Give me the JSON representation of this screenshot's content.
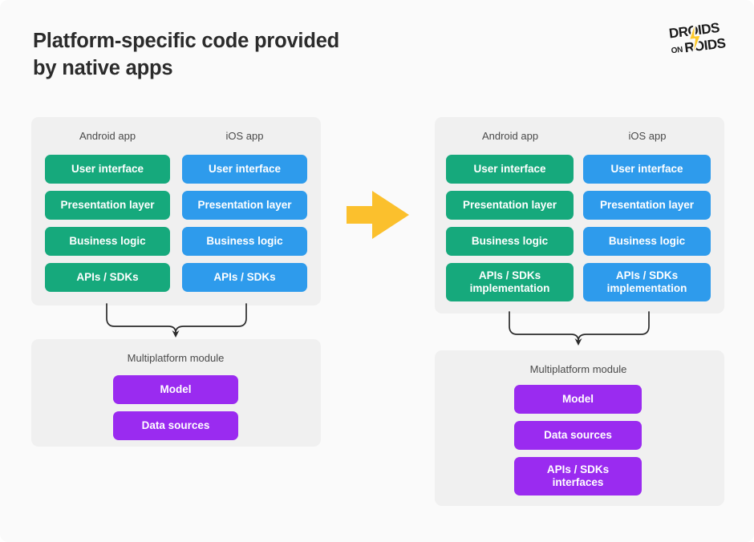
{
  "page": {
    "background_color": "#fafafa",
    "title": "Platform-specific code provided\nby native apps"
  },
  "logo": {
    "name": "droids-on-roids-logo",
    "line1": "DROIDS",
    "line2_prefix": "ON",
    "line2": "ROIDS",
    "bolt_color": "#ffc929",
    "text_color": "#1a1a1a"
  },
  "colors": {
    "android": "#16a97c",
    "ios": "#2e9bec",
    "multiplatform": "#9a2bf0",
    "arrow": "#fbc02d",
    "panel": "#f0f0f0",
    "connector": "#2b2b2b"
  },
  "center_arrow": {
    "name": "transition-arrow",
    "direction": "right",
    "color": "#fbc02d"
  },
  "before": {
    "apps_panel": {
      "columns": [
        {
          "label": "Android app",
          "color": "#16a97c",
          "boxes": [
            "User interface",
            "Presentation layer",
            "Business logic",
            "APIs / SDKs"
          ]
        },
        {
          "label": "iOS app",
          "color": "#2e9bec",
          "boxes": [
            "User interface",
            "Presentation layer",
            "Business logic",
            "APIs / SDKs"
          ]
        }
      ]
    },
    "module_panel": {
      "label": "Multiplatform module",
      "color": "#9a2bf0",
      "boxes": [
        "Model",
        "Data sources"
      ]
    }
  },
  "after": {
    "apps_panel": {
      "columns": [
        {
          "label": "Android app",
          "color": "#16a97c",
          "boxes": [
            "User interface",
            "Presentation layer",
            "Business logic",
            "APIs / SDKs\nimplementation"
          ]
        },
        {
          "label": "iOS app",
          "color": "#2e9bec",
          "boxes": [
            "User interface",
            "Presentation layer",
            "Business logic",
            "APIs / SDKs\nimplementation"
          ]
        }
      ]
    },
    "module_panel": {
      "label": "Multiplatform module",
      "color": "#9a2bf0",
      "boxes": [
        "Model",
        "Data sources",
        "APIs / SDKs\ninterfaces"
      ]
    }
  }
}
